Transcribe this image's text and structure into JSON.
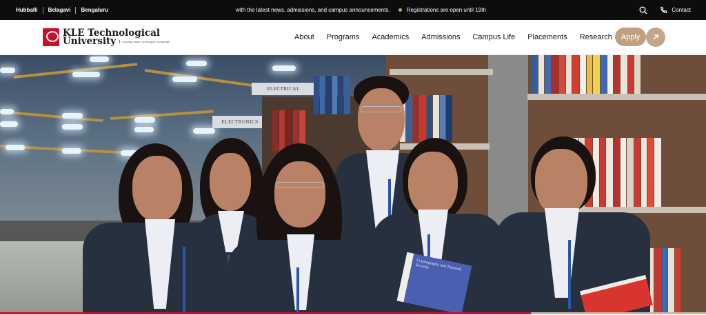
{
  "topbar": {
    "campuses": [
      "Hubballi",
      "Belagavi",
      "Bengaluru"
    ],
    "ticker": [
      "with the latest news, admissions, and campus announcements.",
      "Registrations are open until 19th"
    ],
    "contact_label": "Contact",
    "search_icon": "search-icon",
    "phone_icon": "phone-icon"
  },
  "header": {
    "logo": {
      "line1": "KLE Technological",
      "line2": "University",
      "tagline": "Creating Value, Leveraging Knowledge",
      "mark_text": "KLE TECH"
    },
    "nav": [
      "About",
      "Programs",
      "Academics",
      "Admissions",
      "Campus Life",
      "Placements",
      "Research"
    ],
    "apply_label": "Apply",
    "arrow_icon": "arrow-up-right-icon"
  },
  "hero": {
    "signs": [
      "ELECTRICAL",
      "ELECTRONICS"
    ],
    "book_titles": [
      "Cryptography and Network Security"
    ]
  },
  "colors": {
    "brand_red": "#c8102e",
    "accent_tan": "#bfa080",
    "topbar_bg": "#0d0d0d"
  }
}
